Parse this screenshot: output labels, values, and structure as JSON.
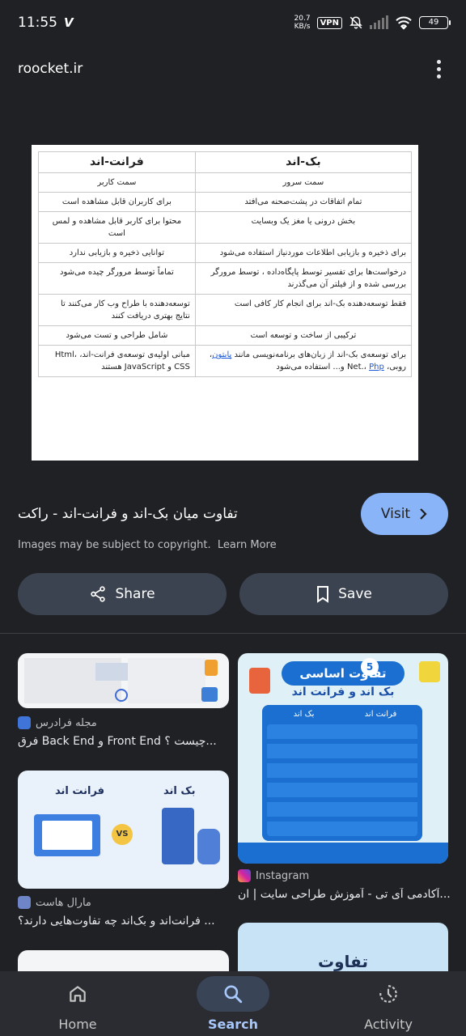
{
  "status": {
    "time": "11:55",
    "net_speed_value": "20.7",
    "net_speed_unit": "KB/s",
    "vpn": "VPN",
    "battery": "49"
  },
  "header": {
    "site": "roocket.ir"
  },
  "main_image": {
    "col_back": "بک-اند",
    "col_front": "فرانت-اند",
    "rows": [
      {
        "back": "سمت سرور",
        "front": "سمت کاربر"
      },
      {
        "back": "تمام اتفاقات در پشت‌صحنه می‌افتد",
        "front": "برای کاربران قابل مشاهده است"
      },
      {
        "back": "بخش درونی یا مغز یک وبسایت",
        "front": "محتوا برای کاربر قابل مشاهده و لمس است"
      },
      {
        "back": "برای ذخیره و بازیابی اطلاعات موردنیاز استفاده می‌شود",
        "front": "توانایی ذخیره و بازیابی ندارد"
      },
      {
        "back": "درخواست‌ها برای تفسیر توسط پایگاه‌داده ، توسط مرورگر بررسی شده و از فیلتر آن می‌گذرند",
        "front": "تماماً توسط مرورگر چیده می‌شود"
      },
      {
        "back": "فقط توسعه‌دهنده بک-اند برای انجام کار کافی است",
        "front": "توسعه‌دهنده با طراح وب کار می‌کنند تا نتایج بهتری دریافت کنند"
      },
      {
        "back": "ترکیبی از ساخت و توسعه است",
        "front": "شامل طراحی و تست می‌شود"
      },
      {
        "back_prefix": "برای توسعه‌ی بک-اند از زبان‌های برنامه‌نویسی مانند ",
        "back_link1": "پایتون",
        "back_mid": "، روبی، Net.، ",
        "back_link2": "Php",
        "back_suffix": " و... استفاده می‌شود",
        "front": "مبانی اولیه‌ی توسعه‌ی فرانت-اند، Html، CSS و JavaScript هستند"
      }
    ]
  },
  "result": {
    "title": "تفاوت میان بک-اند و فرانت-اند - راکت",
    "visit_label": "Visit",
    "copyright": "Images may be subject to copyright.",
    "learn_more": "Learn More",
    "share_label": "Share",
    "save_label": "Save"
  },
  "related": [
    {
      "source": "مجله فرادرس",
      "caption": "فرق Back End و Front End چیست ؟..."
    },
    {
      "source": "Instagram",
      "caption": "آکادمی آی تی - آموزش طراحی سایت | ان...",
      "thumb_title_1": "تفاوت اساسی",
      "thumb_title_2": "بک اند و فرانت اند",
      "thumb_badge": "5",
      "thumb_col_back": "بک اند",
      "thumb_col_front": "فرانت اند"
    },
    {
      "source": "مارال هاست",
      "caption": "فرانت‌اند و بک‌اند چه تفاوت‌هایی دارند؟ ...",
      "thumb_front": "فرانت اند",
      "thumb_back": "بک اند",
      "thumb_vs": "VS"
    },
    {
      "thumb_title": "تفاوت"
    }
  ],
  "nav": {
    "home": "Home",
    "search": "Search",
    "activity": "Activity"
  },
  "colors": {
    "accent": "#8ab4f8",
    "background": "#202124"
  }
}
